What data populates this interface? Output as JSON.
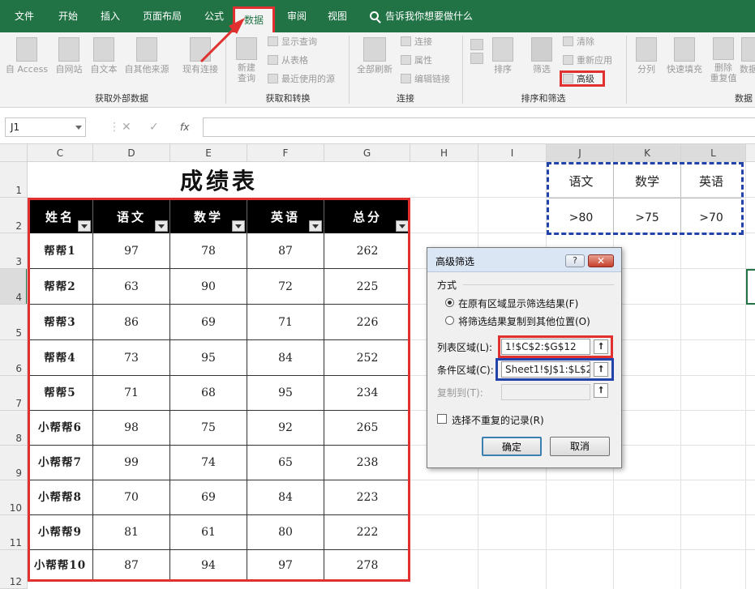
{
  "tabs": [
    "文件",
    "开始",
    "插入",
    "页面布局",
    "公式",
    "数据",
    "审阅",
    "视图"
  ],
  "tell_me": "告诉我你想要做什么",
  "ribbon": {
    "get_external": {
      "access": "自 Access",
      "web": "自网站",
      "text": "自文本",
      "other": "自其他来源",
      "existing": "现有连接",
      "label": "获取外部数据"
    },
    "transform": {
      "new_query_1": "新建",
      "new_query_2": "查询",
      "show_queries": "显示查询",
      "from_table": "从表格",
      "recent_sources": "最近使用的源",
      "label": "获取和转换"
    },
    "connections": {
      "refresh_all": "全部刷新",
      "connections": "连接",
      "properties": "属性",
      "edit_links": "编辑链接",
      "label": "连接"
    },
    "sort_filter": {
      "sort": "排序",
      "filter": "筛选",
      "clear": "清除",
      "reapply": "重新应用",
      "advanced": "高级",
      "label": "排序和筛选"
    },
    "data_tools": {
      "split": "分列",
      "flash_fill": "快速填充",
      "remove_dup_1": "删除",
      "remove_dup_2": "重复值",
      "validate": "数据",
      "label": "数据"
    }
  },
  "formula_bar": {
    "name_box": "J1",
    "cancel": "✕",
    "enter": "✓",
    "fx": "fx",
    "content": ""
  },
  "columns": [
    "C",
    "D",
    "E",
    "F",
    "G",
    "H",
    "I",
    "J",
    "K",
    "L"
  ],
  "rows": [
    "1",
    "2",
    "3",
    "4",
    "5",
    "6",
    "7",
    "8",
    "9",
    "10",
    "11",
    "12"
  ],
  "sheet": {
    "title": "成绩表",
    "headers": [
      "姓名",
      "语文",
      "数学",
      "英语",
      "总分"
    ],
    "records": [
      [
        "帮帮1",
        "97",
        "78",
        "87",
        "262"
      ],
      [
        "帮帮2",
        "63",
        "90",
        "72",
        "225"
      ],
      [
        "帮帮3",
        "86",
        "69",
        "71",
        "226"
      ],
      [
        "帮帮4",
        "73",
        "95",
        "84",
        "252"
      ],
      [
        "帮帮5",
        "71",
        "68",
        "95",
        "234"
      ],
      [
        "小帮帮6",
        "98",
        "75",
        "92",
        "265"
      ],
      [
        "小帮帮7",
        "99",
        "74",
        "65",
        "238"
      ],
      [
        "小帮帮8",
        "70",
        "69",
        "84",
        "223"
      ],
      [
        "小帮帮9",
        "81",
        "61",
        "80",
        "222"
      ],
      [
        "小帮帮10",
        "87",
        "94",
        "97",
        "278"
      ]
    ],
    "criteria_headers": [
      "语文",
      "数学",
      "英语"
    ],
    "criteria_values": [
      ">80",
      ">75",
      ">70"
    ]
  },
  "dialog": {
    "title": "高级筛选",
    "help": "?",
    "close": "✕",
    "method_label": "方式",
    "option1": "在原有区域显示筛选结果(F)",
    "option2": "将筛选结果复制到其他位置(O)",
    "list_label": "列表区域(L):",
    "list_value": "1!$C$2:$G$12",
    "criteria_label": "条件区域(C):",
    "criteria_value": "Sheet1!$J$1:$L$2",
    "copy_label": "复制到(T):",
    "copy_value": "",
    "unique_label": "选择不重复的记录(R)",
    "ok": "确定",
    "cancel": "取消"
  },
  "colors": {
    "excel_green": "#217346",
    "highlight_red": "#e03030",
    "highlight_blue": "#2244aa"
  }
}
